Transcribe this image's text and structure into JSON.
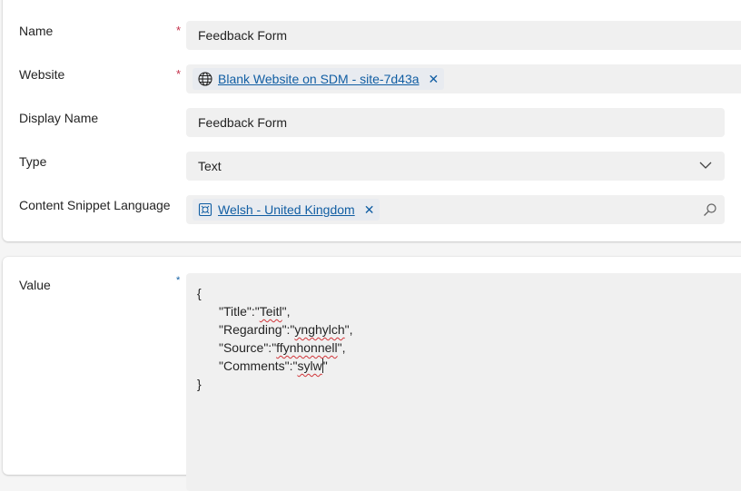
{
  "form": {
    "name": {
      "label": "Name",
      "required_mark": "*",
      "value": "Feedback Form"
    },
    "website": {
      "label": "Website",
      "required_mark": "*",
      "tag": "Blank Website on SDM - site-7d43a",
      "tag_icon": "globe-icon",
      "remove": "✕"
    },
    "display_name": {
      "label": "Display Name",
      "value": "Feedback Form"
    },
    "type": {
      "label": "Type",
      "value": "Text",
      "icon": "chevron-down-icon"
    },
    "language": {
      "label": "Content Snippet Language",
      "tag": "Welsh - United Kingdom",
      "tag_icon": "language-record-icon",
      "remove": "✕",
      "search_icon": "search-icon"
    }
  },
  "value_section": {
    "label": "Value",
    "required_mark": "*",
    "code": {
      "open": "{",
      "lines": [
        {
          "key": "\"Title\":\"",
          "word": "Teitl",
          "end": "\","
        },
        {
          "key": "\"Regarding\":\"",
          "word": "ynghylch",
          "end": "\","
        },
        {
          "key": "\"Source\":\"",
          "word": "ffynhonnell",
          "end": "\","
        },
        {
          "key": "\"Comments\":\"",
          "word": "sylw",
          "end": "\""
        }
      ],
      "close": "}"
    }
  },
  "colors": {
    "link": "#115ea3",
    "required": "#c4314b",
    "field_bg": "#f0f0f0",
    "spell_error": "#d13438"
  }
}
